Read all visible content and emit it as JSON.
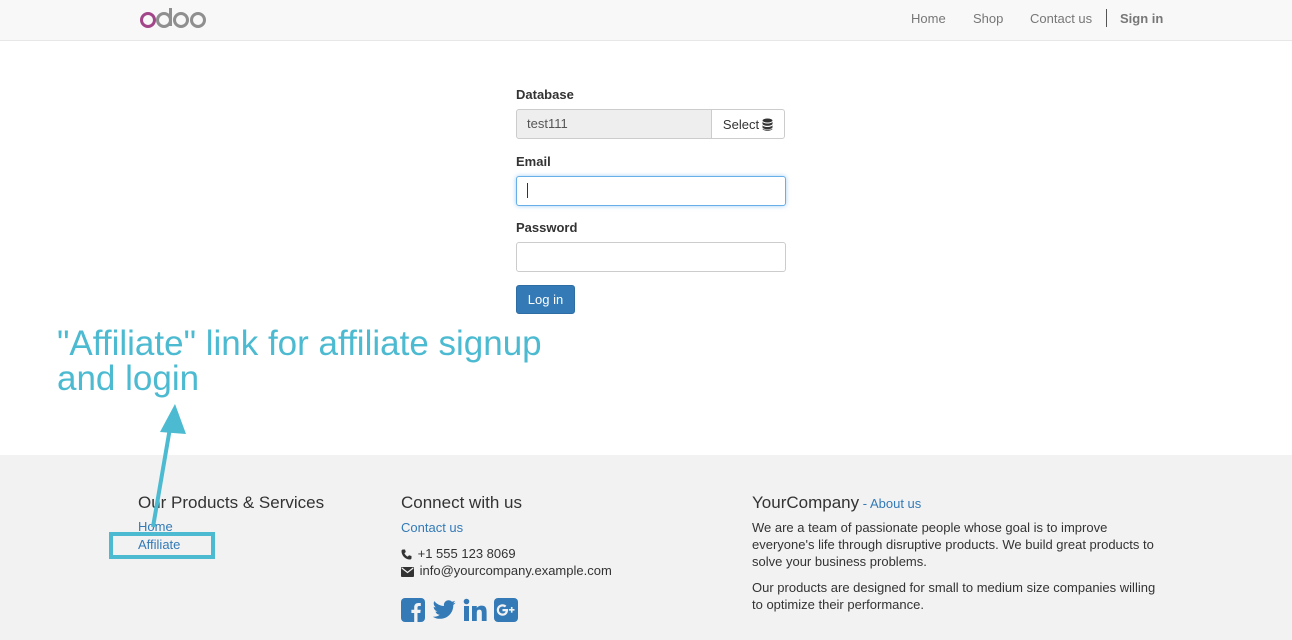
{
  "header": {
    "logo_text": "odoo",
    "nav": {
      "home": "Home",
      "shop": "Shop",
      "contact": "Contact us",
      "signin": "Sign in"
    }
  },
  "login": {
    "database_label": "Database",
    "database_value": "test111",
    "select_label": "Select",
    "email_label": "Email",
    "email_value": "",
    "password_label": "Password",
    "password_value": "",
    "login_button": "Log in"
  },
  "annotation": {
    "line1": "\"Affiliate\" link for affiliate signup",
    "line2": "and login"
  },
  "footer": {
    "products": {
      "heading": "Our Products & Services",
      "links": [
        "Home",
        "Affiliate"
      ]
    },
    "connect": {
      "heading": "Connect with us",
      "contact_link": "Contact us",
      "phone": "+1 555 123 8069",
      "email": "info@yourcompany.example.com",
      "social_icons": [
        "facebook-icon",
        "twitter-icon",
        "linkedin-icon",
        "google-plus-icon"
      ]
    },
    "company": {
      "name": "YourCompany",
      "about_link": "- About us",
      "para1": "We are a team of passionate people whose goal is to improve everyone's life through disruptive products. We build great products to solve your business problems.",
      "para2": "Our products are designed for small to medium size companies willing to optimize their performance."
    }
  },
  "colors": {
    "link": "#337ab7",
    "primary_button": "#337ab7",
    "annotation": "#4cbad0",
    "logo_purple": "#a24689",
    "logo_grey": "#8f8f8f"
  }
}
